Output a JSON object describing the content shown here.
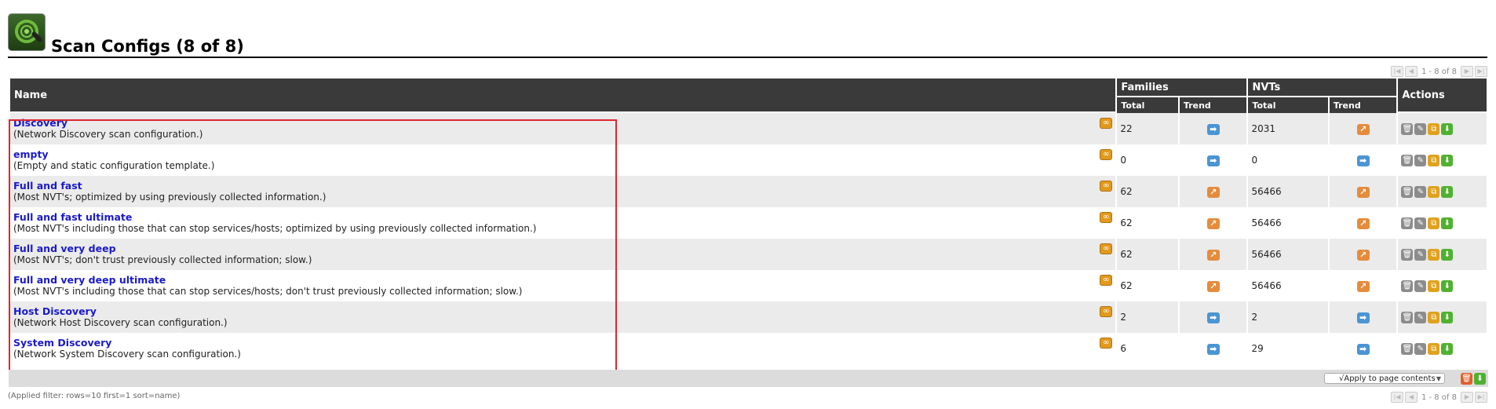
{
  "page": {
    "title": "Scan Configs (8 of 8)",
    "logo_icon": "scan-config-icon"
  },
  "pagination": {
    "range": "1 - 8 of 8",
    "icons": [
      "first-icon",
      "previous-icon",
      "next-icon",
      "last-icon"
    ]
  },
  "table": {
    "headers": {
      "name": "Name",
      "families": "Families",
      "nvts": "NVTs",
      "actions": "Actions",
      "total": "Total",
      "trend": "Trend"
    },
    "rows": [
      {
        "name": "Discovery",
        "comment": "(Network Discovery scan configuration.)",
        "families_total": "22",
        "families_trend": "same",
        "nvts_total": "2031",
        "nvts_trend": "up"
      },
      {
        "name": "empty",
        "comment": "(Empty and static configuration template.)",
        "families_total": "0",
        "families_trend": "same",
        "nvts_total": "0",
        "nvts_trend": "same"
      },
      {
        "name": "Full and fast",
        "comment": "(Most NVT's; optimized by using previously collected information.)",
        "families_total": "62",
        "families_trend": "up",
        "nvts_total": "56466",
        "nvts_trend": "up"
      },
      {
        "name": "Full and fast ultimate",
        "comment": "(Most NVT's including those that can stop services/hosts; optimized by using previously collected information.)",
        "families_total": "62",
        "families_trend": "up",
        "nvts_total": "56466",
        "nvts_trend": "up"
      },
      {
        "name": "Full and very deep",
        "comment": "(Most NVT's; don't trust previously collected information; slow.)",
        "families_total": "62",
        "families_trend": "up",
        "nvts_total": "56466",
        "nvts_trend": "up"
      },
      {
        "name": "Full and very deep ultimate",
        "comment": "(Most NVT's including those that can stop services/hosts; don't trust previously collected information; slow.)",
        "families_total": "62",
        "families_trend": "up",
        "nvts_total": "56466",
        "nvts_trend": "up"
      },
      {
        "name": "Host Discovery",
        "comment": "(Network Host Discovery scan configuration.)",
        "families_total": "2",
        "families_trend": "same",
        "nvts_total": "2",
        "nvts_trend": "same"
      },
      {
        "name": "System Discovery",
        "comment": "(Network System Discovery scan configuration.)",
        "families_total": "6",
        "families_trend": "same",
        "nvts_total": "29",
        "nvts_trend": "same"
      }
    ],
    "trend_icons": {
      "same": "trend-same-icon",
      "up": "trend-up-icon"
    },
    "row_actions": [
      "trash-icon",
      "edit-icon",
      "clone-icon",
      "export-icon"
    ]
  },
  "footer": {
    "apply_select": "√Apply to page contents",
    "bulk_actions": [
      "trash-icon",
      "export-icon"
    ]
  },
  "filter_note": "(Applied filter: rows=10 first=1 sort=name)",
  "colors": {
    "header_bg": "#3a3a3a",
    "link": "#1a1acc",
    "highlight": "#e0262e",
    "trend_same": "#4a95d3",
    "trend_up": "#e58c3c"
  }
}
